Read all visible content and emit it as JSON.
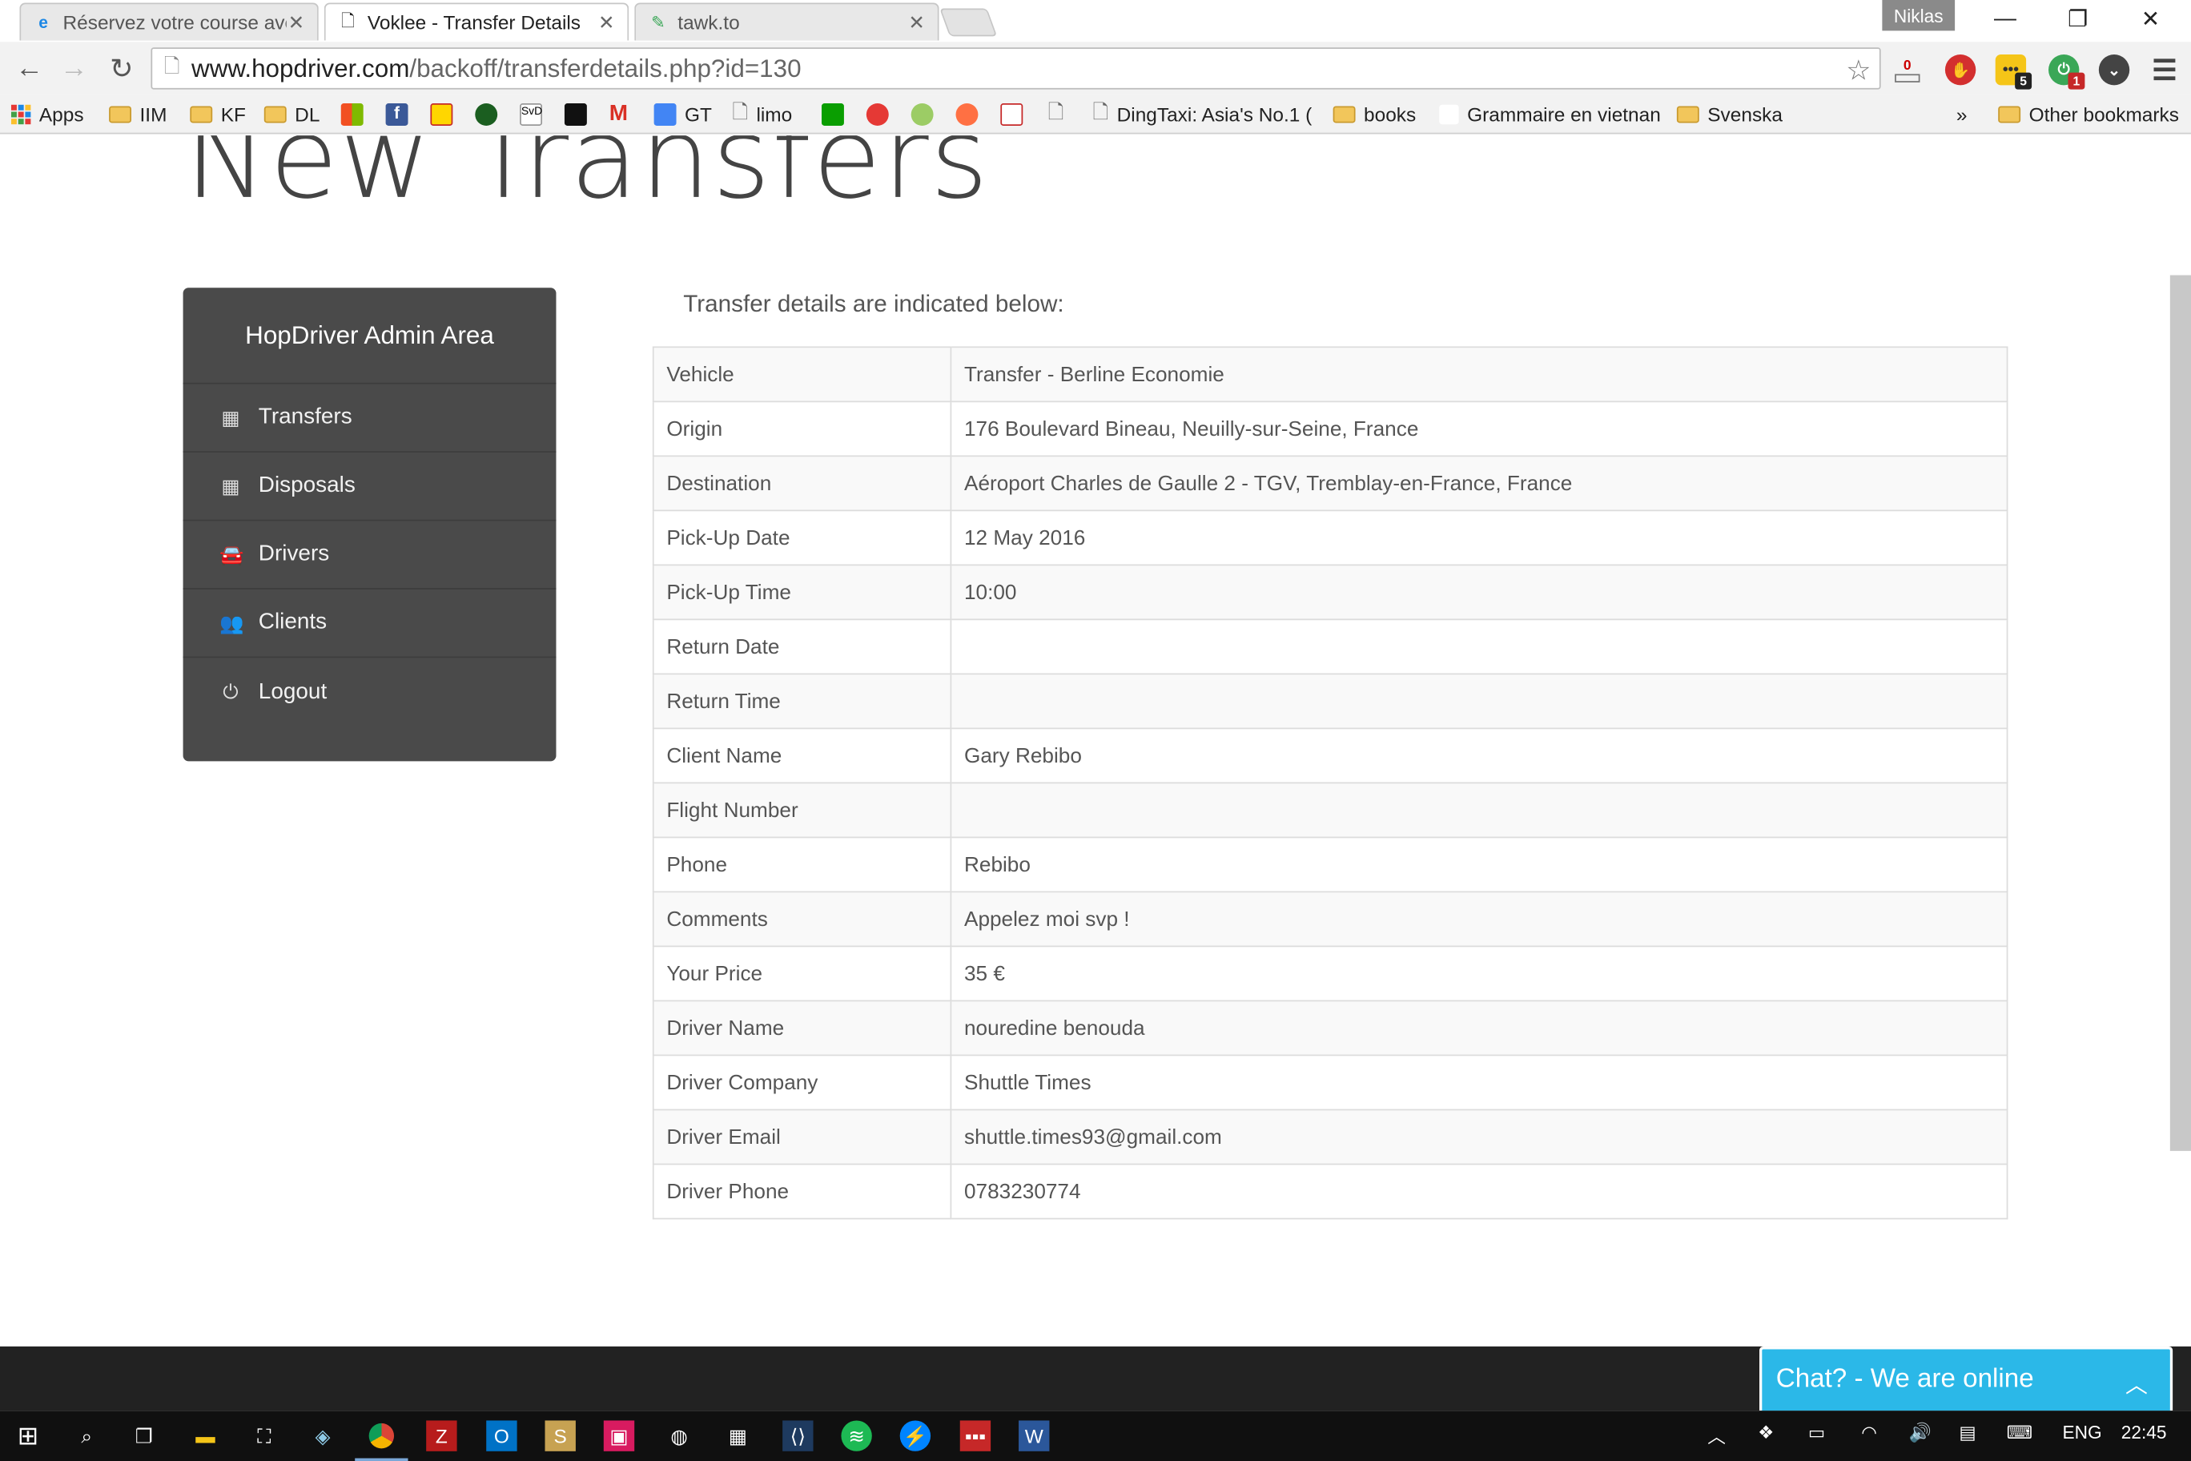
{
  "browser": {
    "tabs": [
      {
        "title": "Réservez votre course ave",
        "active": false
      },
      {
        "title": "Voklee - Transfer Details",
        "active": true
      },
      {
        "title": "tawk.to",
        "active": false
      }
    ],
    "profile": "Niklas",
    "url_host": "www.hopdriver.com",
    "url_path": "/backoff/transferdetails.php?id=130",
    "extensions": {
      "badge_counter": "0",
      "badge_5": "5",
      "badge_1": "1"
    }
  },
  "bookmarks": [
    {
      "label": "Apps",
      "type": "apps"
    },
    {
      "label": "IIM",
      "type": "folder"
    },
    {
      "label": "KF",
      "type": "folder"
    },
    {
      "label": "DL",
      "type": "folder"
    },
    {
      "label": "GT",
      "type": "site"
    },
    {
      "label": "limo",
      "type": "page"
    },
    {
      "label": "DingTaxi: Asia's No.1 (",
      "type": "page"
    },
    {
      "label": "books",
      "type": "folder"
    },
    {
      "label": "Grammaire en vietnan",
      "type": "site"
    },
    {
      "label": "Svenska",
      "type": "folder"
    },
    {
      "label": "»",
      "type": "more"
    },
    {
      "label": "Other bookmarks",
      "type": "folder"
    }
  ],
  "page": {
    "title": "New Transfers",
    "sidebar_title": "HopDriver Admin Area",
    "menu": [
      {
        "label": "Transfers",
        "icon": "calendar-icon"
      },
      {
        "label": "Disposals",
        "icon": "calendar-icon"
      },
      {
        "label": "Drivers",
        "icon": "car-icon"
      },
      {
        "label": "Clients",
        "icon": "users-icon"
      },
      {
        "label": "Logout",
        "icon": "power-icon"
      }
    ],
    "intro": "Transfer details are indicated below:",
    "details": [
      {
        "key": "Vehicle",
        "value": "Transfer - Berline Economie"
      },
      {
        "key": "Origin",
        "value": "176 Boulevard Bineau, Neuilly-sur-Seine, France"
      },
      {
        "key": "Destination",
        "value": "Aéroport Charles de Gaulle 2 - TGV, Tremblay-en-France, France"
      },
      {
        "key": "Pick-Up Date",
        "value": "12 May 2016"
      },
      {
        "key": "Pick-Up Time",
        "value": "10:00"
      },
      {
        "key": "Return Date",
        "value": ""
      },
      {
        "key": "Return Time",
        "value": ""
      },
      {
        "key": "Client Name",
        "value": "Gary Rebibo"
      },
      {
        "key": "Flight Number",
        "value": ""
      },
      {
        "key": "Phone",
        "value": "Rebibo"
      },
      {
        "key": "Comments",
        "value": "Appelez moi svp !"
      },
      {
        "key": "Your Price",
        "value": "35 €"
      },
      {
        "key": "Driver Name",
        "value": "nouredine benouda"
      },
      {
        "key": "Driver Company",
        "value": "Shuttle Times"
      },
      {
        "key": "Driver Email",
        "value": "shuttle.times93@gmail.com"
      },
      {
        "key": "Driver Phone",
        "value": "0783230774"
      }
    ]
  },
  "chat": {
    "label": "Chat? - We are online"
  },
  "taskbar": {
    "language": "ENG",
    "time": "22:45"
  },
  "colors": {
    "sidebar": "#4a4a4a",
    "chat": "#2bb8e8",
    "taskbar": "#101010"
  }
}
